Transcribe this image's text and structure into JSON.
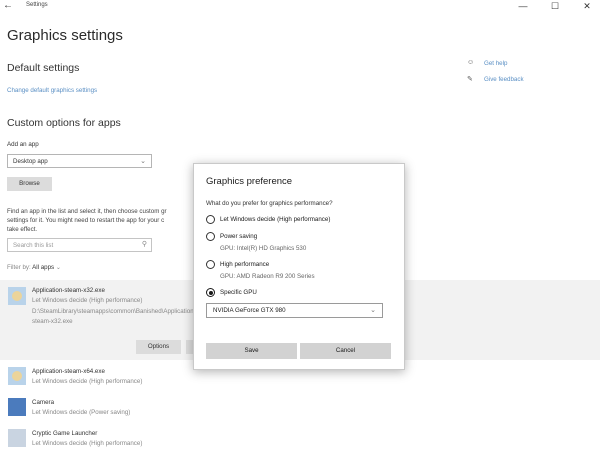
{
  "window": {
    "title": "Settings",
    "back_icon": "back-arrow-icon",
    "controls": [
      "—",
      "☐",
      "✕"
    ]
  },
  "page": {
    "title": "Graphics settings"
  },
  "default_settings": {
    "heading": "Default settings",
    "link": "Change default graphics settings"
  },
  "help": {
    "get_help": "Get help",
    "give_feedback": "Give feedback"
  },
  "custom": {
    "heading": "Custom options for apps",
    "add_label": "Add an app",
    "app_type_value": "Desktop app",
    "browse_label": "Browse",
    "description_lines": [
      "Find an app in the list and select it, then choose custom gr",
      "settings for it. You might need to restart the app for your c",
      "take effect."
    ],
    "search_placeholder": "Search this list",
    "filter_label": "Filter by:",
    "filter_value": "All apps",
    "options_label": "Options"
  },
  "apps": [
    {
      "name": "Application-steam-x32.exe",
      "status": "Let Windows decide (High performance)",
      "path_lines": [
        "D:\\SteamLibrary\\steamapps\\common\\Banished\\Application-",
        "steam-x32.exe"
      ]
    },
    {
      "name": "Application-steam-x64.exe",
      "status": "Let Windows decide (High performance)"
    },
    {
      "name": "Camera",
      "status": "Let Windows decide (Power saving)"
    },
    {
      "name": "Cryptic Game Launcher",
      "status": "Let Windows decide (High performance)"
    }
  ],
  "dialog": {
    "title": "Graphics preference",
    "question": "What do you prefer for graphics performance?",
    "options": [
      {
        "label": "Let Windows decide (High performance)",
        "gpu": ""
      },
      {
        "label": "Power saving",
        "gpu": "GPU: Intel(R) HD Graphics 530"
      },
      {
        "label": "High performance",
        "gpu": "GPU: AMD Radeon R9 200 Series"
      },
      {
        "label": "Specific GPU",
        "gpu": ""
      }
    ],
    "selected_option": "Specific GPU",
    "gpu_select_value": "NVIDIA GeForce GTX 980",
    "save_label": "Save",
    "cancel_label": "Cancel"
  }
}
